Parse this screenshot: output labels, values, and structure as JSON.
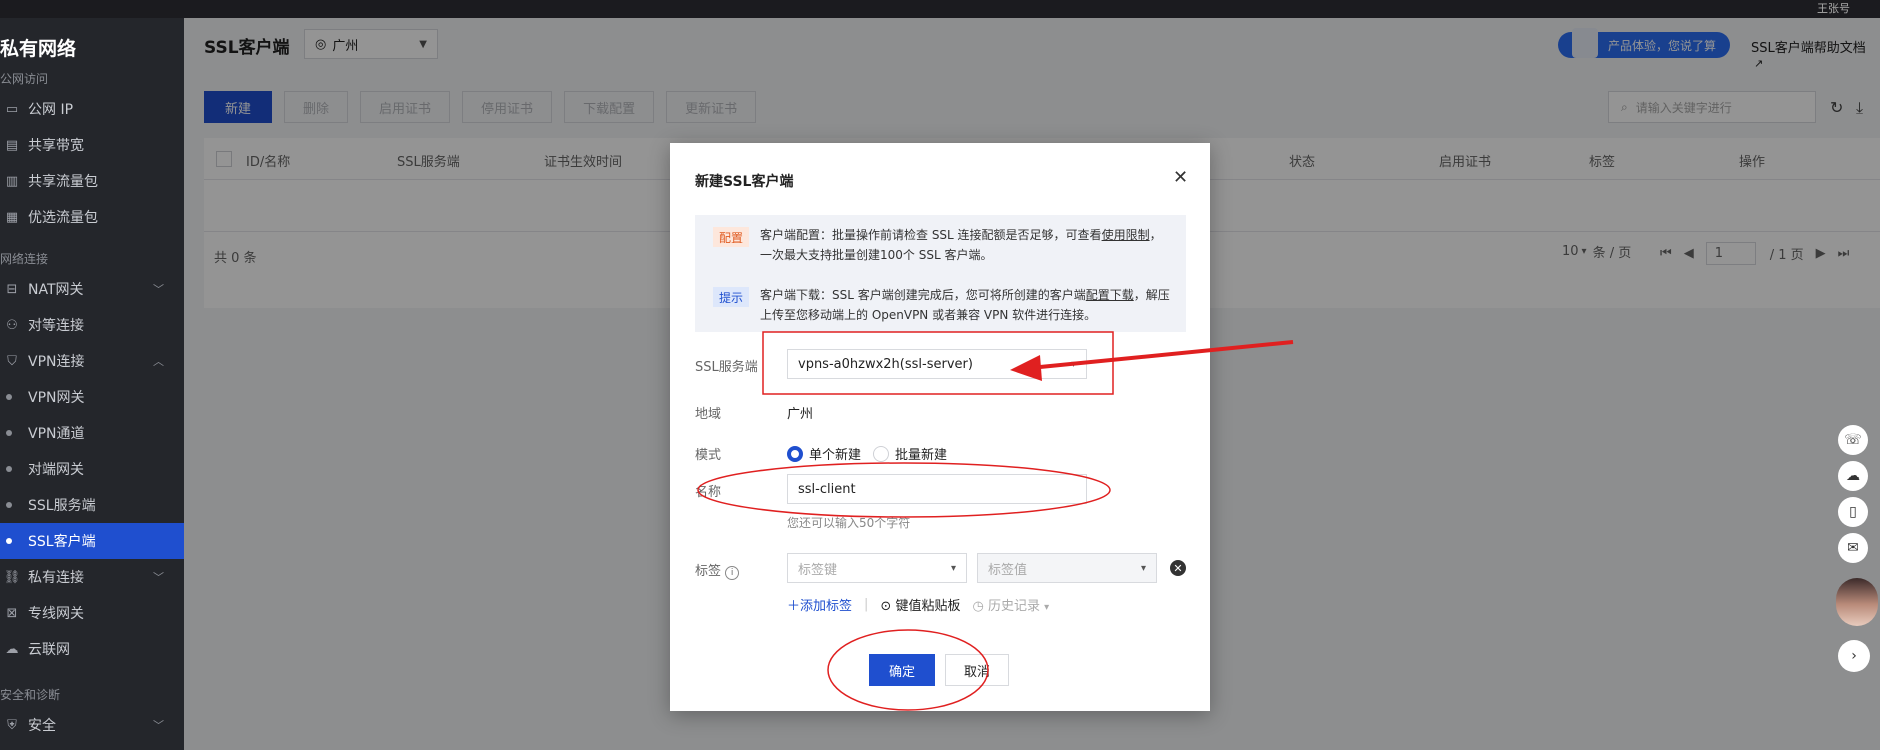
{
  "topbar": {
    "user": "王张号"
  },
  "sidebar": {
    "title": "私有网络",
    "groups": {
      "public": "公网访问",
      "connect": "网络连接",
      "security": "安全和诊断"
    },
    "items": [
      {
        "label": "公网 IP",
        "icon": "ip-icon"
      },
      {
        "label": "共享带宽",
        "icon": "bandwidth-icon"
      },
      {
        "label": "共享流量包",
        "icon": "traffic-package-icon"
      },
      {
        "label": "优选流量包",
        "icon": "preferred-package-icon"
      },
      {
        "label": "NAT网关",
        "icon": "nat-icon"
      },
      {
        "label": "对等连接",
        "icon": "peering-icon"
      },
      {
        "label": "VPN连接",
        "icon": "vpn-icon"
      },
      {
        "label": "VPN网关"
      },
      {
        "label": "VPN通道"
      },
      {
        "label": "对端网关"
      },
      {
        "label": "SSL服务端"
      },
      {
        "label": "SSL客户端"
      },
      {
        "label": "私有连接",
        "icon": "private-link-icon"
      },
      {
        "label": "专线网关",
        "icon": "dc-gateway-icon"
      },
      {
        "label": "云联网",
        "icon": "ccn-icon"
      },
      {
        "label": "安全",
        "icon": "shield-icon"
      }
    ]
  },
  "header": {
    "title": "SSL客户端",
    "region": "广州",
    "promo": "产品体验，您说了算",
    "helpdoc": "SSL客户端帮助文档"
  },
  "toolbar": {
    "new": "新建",
    "delete": "删除",
    "enable": "启用证书",
    "disable": "停用证书",
    "download": "下载配置",
    "update": "更新证书",
    "search_placeholder": "请输入关键字进行"
  },
  "table": {
    "columns": [
      "ID/名称",
      "SSL服务端",
      "证书生效时间",
      "状态",
      "启用证书",
      "标签",
      "操作"
    ],
    "total": "共 0 条",
    "page_size": "10",
    "page_size_suffix": "条 / 页",
    "page": "1",
    "page_total": "/ 1 页"
  },
  "dialog": {
    "title": "新建SSL客户端",
    "notice": {
      "cfg_badge": "配置",
      "cfg_text": "客户端配置：批量操作前请检查 SSL 连接配额是否足够，可查看",
      "cfg_link": "使用限制",
      "cfg_text2": "，一次最大支持批量创建100个 SSL 客户端。",
      "tip_badge": "提示",
      "tip_text": "客户端下载：SSL 客户端创建完成后，您可将所创建的客户端",
      "tip_link": "配置下载",
      "tip_text2": "，解压上传至您移动端上的 OpenVPN 或者兼容 VPN 软件进行连接。"
    },
    "fields": {
      "server_label": "SSL服务端",
      "server_value": "vpns-a0hzwx2h(ssl-server)",
      "region_label": "地域",
      "region_value": "广州",
      "mode_label": "模式",
      "mode_single": "单个新建",
      "mode_batch": "批量新建",
      "name_label": "名称",
      "name_value": "ssl-client",
      "name_hint": "您还可以输入50个字符",
      "tag_label": "标签",
      "tag_key_placeholder": "标签键",
      "tag_value_placeholder": "标签值",
      "add_tag": "添加标签",
      "paste": "键值粘贴板",
      "history": "历史记录"
    },
    "ok": "确定",
    "cancel": "取消"
  },
  "annotation_color": "#e02020"
}
